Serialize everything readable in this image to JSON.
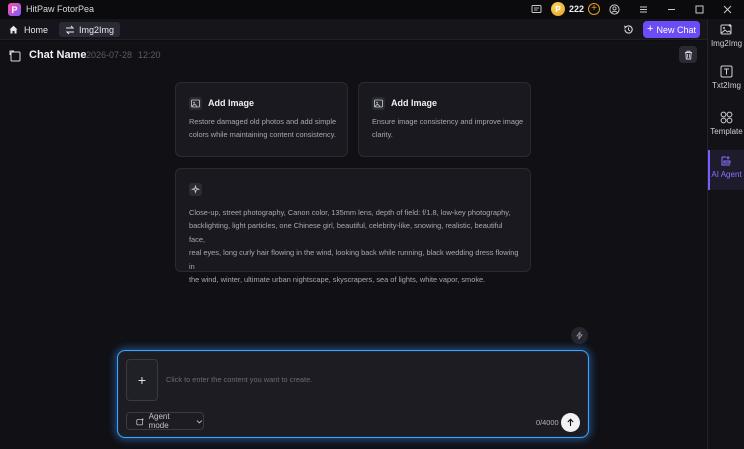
{
  "app": {
    "title": "HitPaw FotorPea",
    "logo_letter": "P"
  },
  "titlebar": {
    "coins": "222",
    "coin_symbol": "P"
  },
  "tabs": {
    "home_label": "Home",
    "active_label": "Img2Img"
  },
  "toolbar": {
    "new_chat_label": "New Chat"
  },
  "sidebar": {
    "items": [
      {
        "label": "Img2Img",
        "icon": "image-icon"
      },
      {
        "label": "Txt2Img",
        "icon": "text-image-icon"
      },
      {
        "label": "Template",
        "icon": "template-grid-icon"
      },
      {
        "label": "AI Agent",
        "icon": "ai-agent-icon",
        "active": true
      }
    ]
  },
  "chat": {
    "name": "Chat Name",
    "date": "2026-07-28",
    "time": "12:20"
  },
  "cards": [
    {
      "title": "Add Image",
      "desc_lines": [
        "Restore damaged old photos and add simple",
        "colors while maintaining content consistency."
      ]
    },
    {
      "title": "Add Image",
      "desc_lines": [
        "Ensure image consistency and improve image",
        "clarity."
      ]
    }
  ],
  "prompt_card": {
    "lines": [
      "Close-up, street photography, Canon color, 135mm lens, depth of field: f/1.8, low-key photography,",
      "backlighting, light particles, one Chinese girl, beautiful, celebrity-like, snowing, realistic, beautiful face,",
      "real eyes, long curly hair flowing in the wind, looking back while running, black wedding dress flowing in",
      "the wind, winter, ultimate urban nightscape, skyscrapers, sea of lights, white vapor, smoke."
    ]
  },
  "composer": {
    "placeholder": "Click to enter the content you want to create.",
    "mode_label": "Agent mode",
    "char_count": "0/4000",
    "accent": "#3aa4ff"
  },
  "colors": {
    "primary": "#6b4cf5",
    "active": "#8c75ff",
    "coin": "#e5a11f"
  }
}
